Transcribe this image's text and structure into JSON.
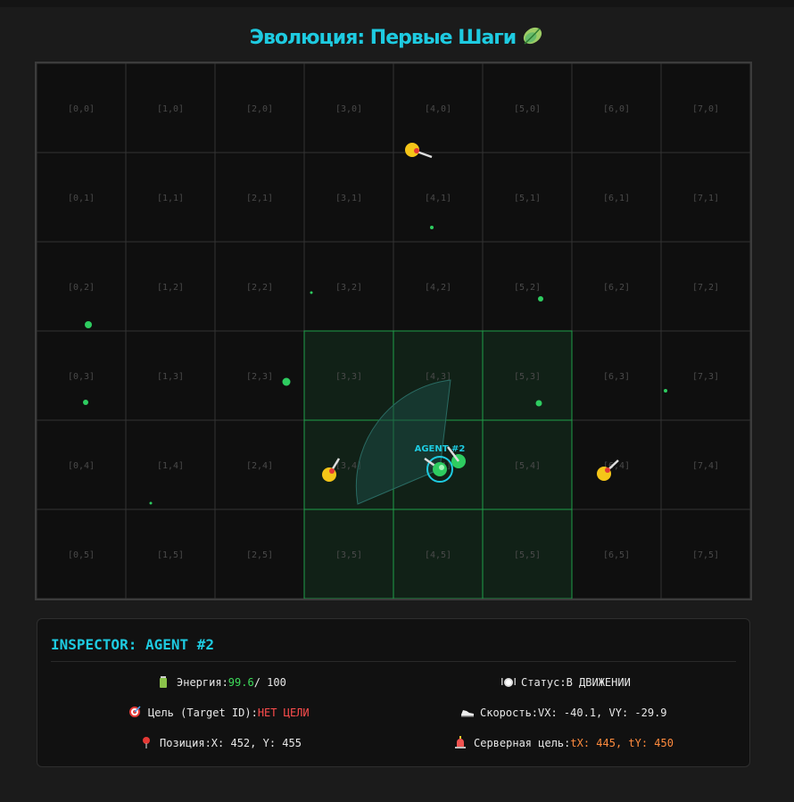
{
  "app": {
    "title": "Эволюция: Первые Шаги",
    "title_icon": "leaf-icon"
  },
  "grid": {
    "columns": 8,
    "rows": 6,
    "cell_labels": [
      [
        "[0,0]",
        "[1,0]",
        "[2,0]",
        "[3,0]",
        "[4,0]",
        "[5,0]",
        "[6,0]",
        "[7,0]"
      ],
      [
        "[0,1]",
        "[1,1]",
        "[2,1]",
        "[3,1]",
        "[4,1]",
        "[5,1]",
        "[6,1]",
        "[7,1]"
      ],
      [
        "[0,2]",
        "[1,2]",
        "[2,2]",
        "[3,2]",
        "[4,2]",
        "[5,2]",
        "[6,2]",
        "[7,2]"
      ],
      [
        "[0,3]",
        "[1,3]",
        "[2,3]",
        "[3,3]",
        "[4,3]",
        "[5,3]",
        "[6,3]",
        "[7,3]"
      ],
      [
        "[0,4]",
        "[1,4]",
        "[2,4]",
        "[3,4]",
        "[4,4]",
        "[5,4]",
        "[6,4]",
        "[7,4]"
      ],
      [
        "[0,5]",
        "[1,5]",
        "[2,5]",
        "[3,5]",
        "[4,5]",
        "[5,5]",
        "[6,5]",
        "[7,5]"
      ]
    ],
    "highlighted_cells": [
      [
        3,
        3
      ],
      [
        4,
        3
      ],
      [
        5,
        3
      ],
      [
        3,
        4
      ],
      [
        4,
        4
      ],
      [
        5,
        4
      ],
      [
        3,
        5
      ],
      [
        4,
        5
      ],
      [
        5,
        5
      ]
    ],
    "colors": {
      "background": "#0f0f0f",
      "line": "#333333",
      "highlight_fill": "#112117",
      "highlight_line": "#1f9e4a",
      "label": "#4a4a4a"
    }
  },
  "world": {
    "selected_agent_label": "AGENT #2",
    "colors": {
      "agent": "#f5c518",
      "agent_nose": "#e53935",
      "food": "#2ecc60",
      "selected": "#2ecc60",
      "selection_ring": "#1ecbe1",
      "vision_cone": "#1b4a44"
    }
  },
  "inspector": {
    "title": "INSPECTOR: AGENT #2",
    "energy": {
      "icon": "battery-icon",
      "label": "Энергия:",
      "value": "99.6",
      "max": "/ 100"
    },
    "status": {
      "icon": "plate-icon",
      "label": "Статус:",
      "value": "В ДВИЖЕНИИ"
    },
    "target": {
      "icon": "target-icon",
      "label": "Цель (Target ID):",
      "value": "НЕТ ЦЕЛИ"
    },
    "speed": {
      "icon": "sneaker-icon",
      "label": "Скорость:",
      "value": "VX: -40.1, VY: -29.9"
    },
    "position": {
      "icon": "pin-icon",
      "label": "Позиция:",
      "value": "X: 452, Y: 455"
    },
    "server_target": {
      "icon": "siren-icon",
      "label": "Серверная цель:",
      "value": "tX: 445, tY: 450"
    }
  }
}
